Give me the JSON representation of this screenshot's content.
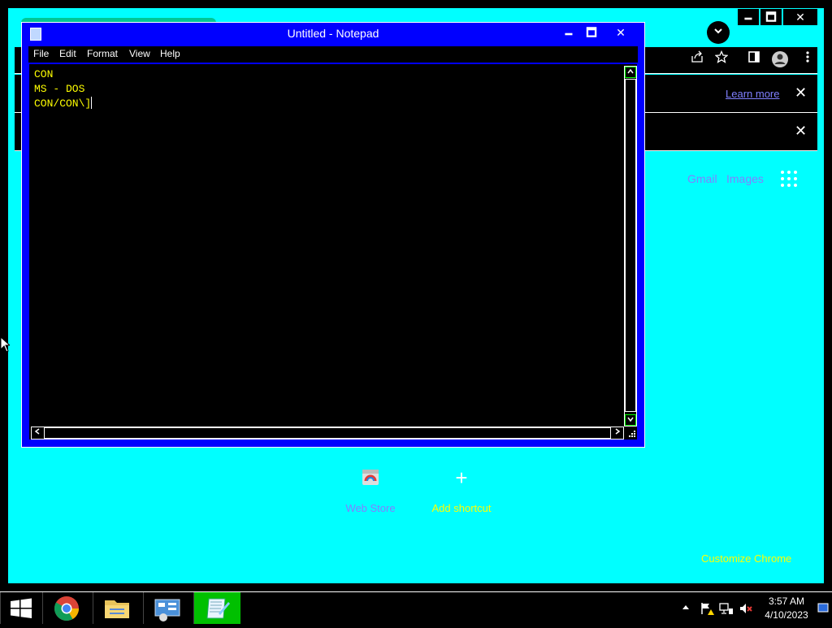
{
  "chrome": {
    "window_controls": {
      "minimize": "🗕",
      "maximize": "🗖",
      "close": "✕"
    },
    "tab_search_icon": "chevron-down-icon",
    "toolbar_icons": [
      "share-icon",
      "star-icon",
      "side-panel-icon",
      "profile-icon",
      "menu-dots-icon"
    ],
    "infobar1": {
      "link": "Learn more",
      "close": "✕"
    },
    "infobar2": {
      "close": "✕"
    },
    "ntp": {
      "gmail": "Gmail",
      "images": "Images",
      "shortcuts": [
        {
          "label": "Web Store",
          "icon": "web-store-icon"
        },
        {
          "label": "Add shortcut",
          "icon": "+"
        }
      ],
      "customize": "Customize Chrome"
    },
    "colors": {
      "frame": "#00ffff",
      "link": "#8080ff",
      "highlight_text": "#ffff00"
    }
  },
  "notepad": {
    "title": "Untitled - Notepad",
    "window_controls": {
      "minimize": "🗕",
      "maximize": "🗖",
      "close": "✕"
    },
    "menu": [
      "File",
      "Edit",
      "Format",
      "View",
      "Help"
    ],
    "lines": [
      "CON",
      "MS - DOS",
      "CON/CON\\]"
    ],
    "colors": {
      "frame": "#0000ff",
      "text": "#ffff00",
      "background": "#000000"
    }
  },
  "taskbar": {
    "apps": [
      "windows-start-icon",
      "chrome-icon",
      "file-explorer-icon",
      "control-panel-icon",
      "notepad-icon"
    ],
    "active_app": "notepad-icon",
    "tray_icons": [
      "flag-warning-icon",
      "network-icon",
      "volume-muted-icon"
    ],
    "time": "3:57 AM",
    "date": "4/10/2023"
  }
}
